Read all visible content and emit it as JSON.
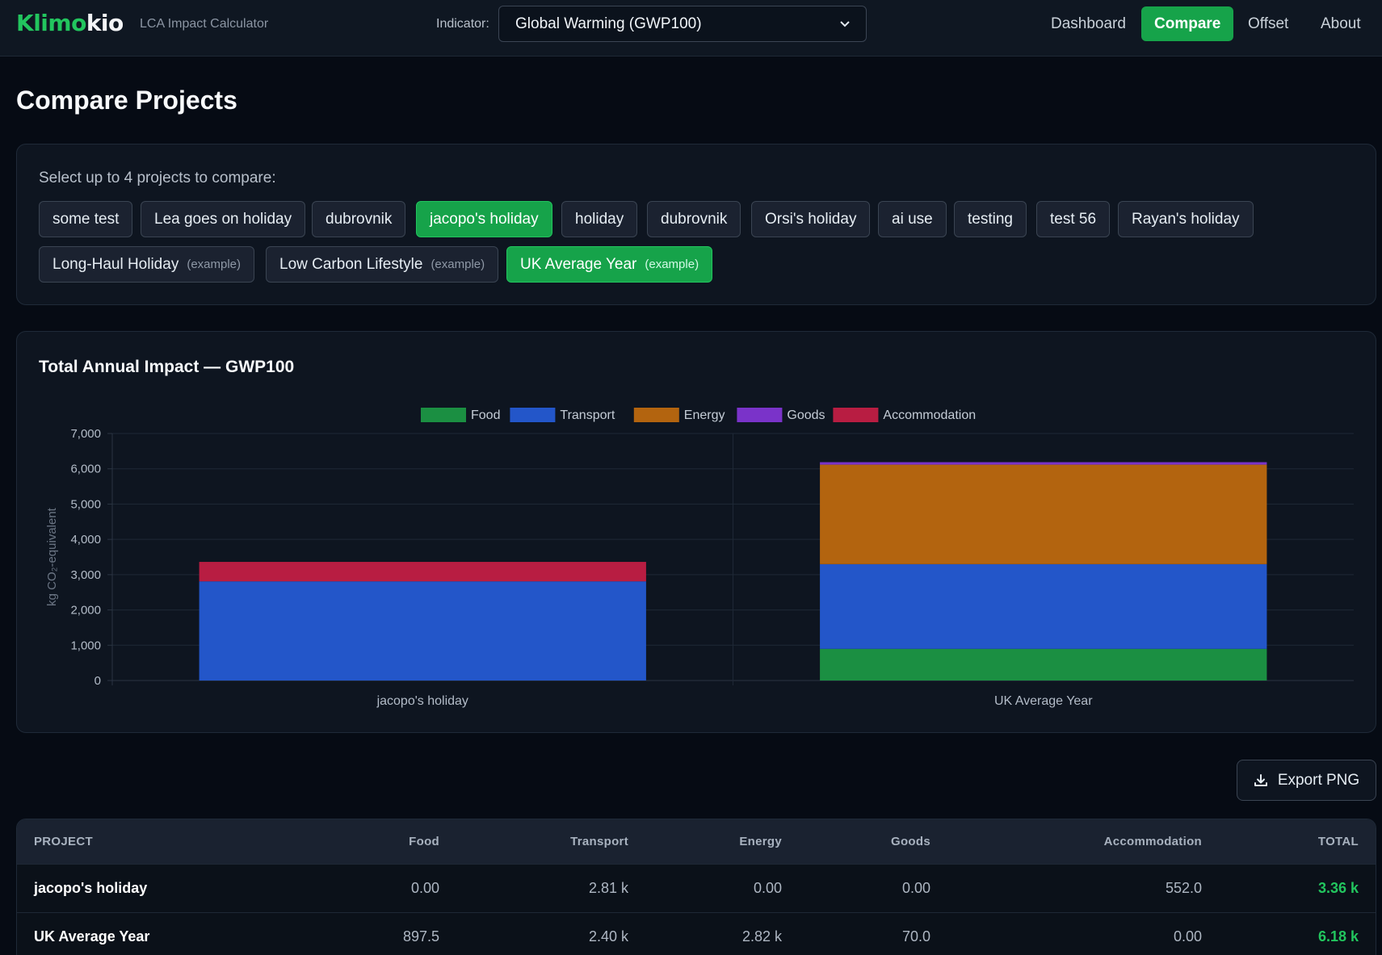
{
  "header": {
    "brand_part1": "Klimo",
    "brand_part2": "kio",
    "subtitle": "LCA Impact Calculator",
    "indicator_label": "Indicator:",
    "indicator_value": "Global Warming (GWP100)",
    "nav": [
      "Dashboard",
      "Compare",
      "Offset",
      "About"
    ],
    "nav_active": "Compare"
  },
  "page": {
    "title": "Compare Projects"
  },
  "selector": {
    "label": "Select up to 4 projects to compare:",
    "projects": [
      {
        "name": "some test",
        "selected": false
      },
      {
        "name": "Lea goes on holiday",
        "selected": false
      },
      {
        "name": "dubrovnik",
        "selected": false
      },
      {
        "name": "jacopo's holiday",
        "selected": true
      },
      {
        "name": "holiday",
        "selected": false
      },
      {
        "name": "dubrovnik",
        "selected": false
      },
      {
        "name": "Orsi's holiday",
        "selected": false
      },
      {
        "name": "ai use",
        "selected": false
      },
      {
        "name": "testing",
        "selected": false
      },
      {
        "name": "test 56",
        "selected": false
      },
      {
        "name": "Rayan's holiday",
        "selected": false
      },
      {
        "name": "Long-Haul Holiday",
        "tag": "(example)",
        "selected": false
      },
      {
        "name": "Low Carbon Lifestyle",
        "tag": "(example)",
        "selected": false
      },
      {
        "name": "UK Average Year",
        "tag": "(example)",
        "selected": true
      }
    ]
  },
  "chart_data": {
    "type": "bar",
    "stacked": true,
    "title": "Total Annual Impact — GWP100",
    "xlabel": "",
    "ylabel": "kg CO₂-equivalent",
    "ylim": [
      0,
      7000
    ],
    "yticks": [
      "0",
      "1,000",
      "2,000",
      "3,000",
      "4,000",
      "5,000",
      "6,000",
      "7,000"
    ],
    "categories": [
      "jacopo's holiday",
      "UK Average Year"
    ],
    "grid": true,
    "legend_position": "top-center",
    "series": [
      {
        "name": "Food",
        "color": "#1b8f42",
        "values": [
          0,
          897.5
        ]
      },
      {
        "name": "Transport",
        "color": "#2356c9",
        "values": [
          2810,
          2400
        ]
      },
      {
        "name": "Energy",
        "color": "#b3640f",
        "values": [
          0,
          2820
        ]
      },
      {
        "name": "Goods",
        "color": "#7a33c9",
        "values": [
          0,
          70
        ]
      },
      {
        "name": "Accommodation",
        "color": "#b81d42",
        "values": [
          552,
          0
        ]
      }
    ]
  },
  "export": {
    "label": "Export PNG"
  },
  "table": {
    "headers": [
      "PROJECT",
      "Food",
      "Transport",
      "Energy",
      "Goods",
      "Accommodation",
      "TOTAL"
    ],
    "rows": [
      [
        "jacopo's holiday",
        "0.00",
        "2.81 k",
        "0.00",
        "0.00",
        "552.0",
        "3.36 k"
      ],
      [
        "UK Average Year",
        "897.5",
        "2.40 k",
        "2.82 k",
        "70.0",
        "0.00",
        "6.18 k"
      ]
    ]
  },
  "colors": {
    "accent": "#16a34a",
    "background": "#060b14",
    "card": "#0e1520"
  }
}
